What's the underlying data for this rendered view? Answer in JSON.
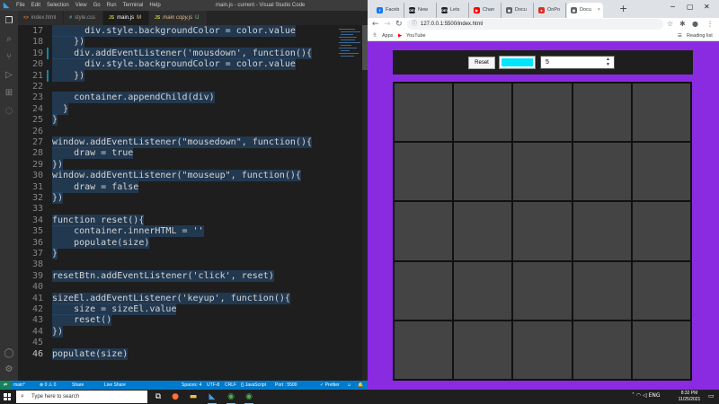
{
  "vscode": {
    "menu": [
      "File",
      "Edit",
      "Selection",
      "View",
      "Go",
      "Run",
      "Terminal",
      "Help"
    ],
    "window_title": "main.js - current - Visual Studio Code",
    "tabs": [
      {
        "icon": "<>",
        "label": "index.html",
        "suffix": ""
      },
      {
        "icon": "#",
        "label": "style.css",
        "suffix": ""
      },
      {
        "icon": "JS",
        "label": "main.js",
        "suffix": "M"
      },
      {
        "icon": "JS",
        "label": "main copy.js",
        "suffix": "U"
      }
    ],
    "lines": [
      {
        "num": "17",
        "text": "      div.style.backgroundColor = color.value"
      },
      {
        "num": "18",
        "text": "    })"
      },
      {
        "num": "19",
        "text": "    div.addEventListener('mousdown', function(){"
      },
      {
        "num": "20",
        "text": "      div.style.backgroundColor = color.value"
      },
      {
        "num": "21",
        "text": "    })"
      },
      {
        "num": "22",
        "text": ""
      },
      {
        "num": "23",
        "text": "    container.appendChild(div)"
      },
      {
        "num": "24",
        "text": "  }"
      },
      {
        "num": "25",
        "text": "}"
      },
      {
        "num": "26",
        "text": ""
      },
      {
        "num": "27",
        "text": "window.addEventListener(\"mousedown\", function(){"
      },
      {
        "num": "28",
        "text": "    draw = true"
      },
      {
        "num": "29",
        "text": "})"
      },
      {
        "num": "30",
        "text": "window.addEventListener(\"mouseup\", function(){"
      },
      {
        "num": "31",
        "text": "    draw = false"
      },
      {
        "num": "32",
        "text": "})"
      },
      {
        "num": "33",
        "text": ""
      },
      {
        "num": "34",
        "text": "function reset(){"
      },
      {
        "num": "35",
        "text": "    container.innerHTML = ''"
      },
      {
        "num": "36",
        "text": "    populate(size)"
      },
      {
        "num": "37",
        "text": "}"
      },
      {
        "num": "38",
        "text": ""
      },
      {
        "num": "39",
        "text": "resetBtn.addEventListener('click', reset)"
      },
      {
        "num": "40",
        "text": ""
      },
      {
        "num": "41",
        "text": "sizeEl.addEventListener('keyup', function(){"
      },
      {
        "num": "42",
        "text": "    size = sizeEl.value"
      },
      {
        "num": "43",
        "text": "    reset()"
      },
      {
        "num": "44",
        "text": "})"
      },
      {
        "num": "45",
        "text": ""
      },
      {
        "num": "46",
        "text": "populate(size)"
      }
    ],
    "status": {
      "branch": "main*",
      "problems": "⊗ 0 ⚠ 0",
      "share": "Share",
      "live_share": "Live Share",
      "spaces": "Spaces: 4",
      "encoding": "UTF-8",
      "eol": "CRLF",
      "language": "{} JavaScript",
      "port": "Port : 5500",
      "prettier": "✓ Prettier"
    }
  },
  "browser": {
    "tabs": [
      {
        "label": "Faceb",
        "fav_color": "#1877f2",
        "fav_glyph": "f"
      },
      {
        "label": "New",
        "fav_color": "#222222",
        "fav_glyph": "DEV"
      },
      {
        "label": "Lets",
        "fav_color": "#222222",
        "fav_glyph": "DEV"
      },
      {
        "label": "Chan",
        "fav_color": "#ff0000",
        "fav_glyph": "▶"
      },
      {
        "label": "Docu",
        "fav_color": "#5f6368",
        "fav_glyph": "◉"
      },
      {
        "label": "OnPo",
        "fav_color": "#d93025",
        "fav_glyph": "●"
      },
      {
        "label": "Docu",
        "fav_color": "#5f6368",
        "fav_glyph": "◉"
      }
    ],
    "url": "127.0.0.1:5500/index.html",
    "bookmarks": {
      "apps": "Apps",
      "youtube": "YouTube",
      "reading_list": "Reading list"
    },
    "page": {
      "reset_label": "Reset",
      "color_value": "#00e5ff",
      "size_value": "5",
      "grid_size": 5,
      "bg_color": "#8a2be2",
      "cell_color": "#444444"
    }
  },
  "taskbar": {
    "search_placeholder": "Type here to search",
    "time": "8:32 PM",
    "date": "11/25/2021"
  }
}
